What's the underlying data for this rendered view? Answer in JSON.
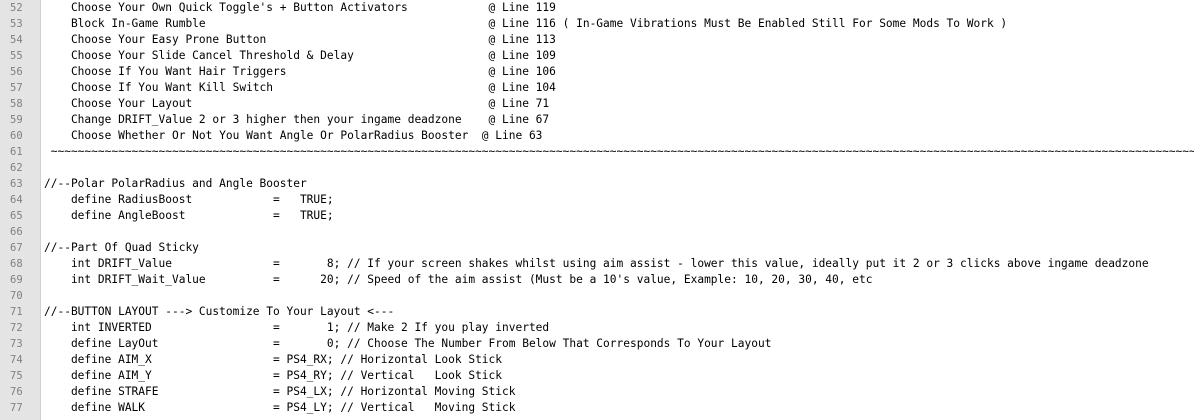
{
  "editor": {
    "lines": [
      {
        "num": "52",
        "text": "    Choose Your Own Quick Toggle's + Button Activators            @ Line 119"
      },
      {
        "num": "53",
        "text": "    Block In-Game Rumble                                          @ Line 116 ( In-Game Vibrations Must Be Enabled Still For Some Mods To Work )"
      },
      {
        "num": "54",
        "text": "    Choose Your Easy Prone Button                                 @ Line 113"
      },
      {
        "num": "55",
        "text": "    Choose Your Slide Cancel Threshold & Delay                    @ Line 109"
      },
      {
        "num": "56",
        "text": "    Choose If You Want Hair Triggers                              @ Line 106"
      },
      {
        "num": "57",
        "text": "    Choose If You Want Kill Switch                                @ Line 104"
      },
      {
        "num": "58",
        "text": "    Choose Your Layout                                            @ Line 71"
      },
      {
        "num": "59",
        "text": "    Change DRIFT_Value 2 or 3 higher then your ingame deadzone    @ Line 67"
      },
      {
        "num": "60",
        "text": "    Choose Whether Or Not You Want Angle Or PolarRadius Booster  @ Line 63"
      },
      {
        "num": "61",
        "text": " ~~~~~~~~~~~~~~~~~~~~~~~~~~~~~~~~~~~~~~~~~~~~~~~~~~~~~~~~~~~~~~~~~~~~~~~~~~~~~~~~~~~~~~~~~~~~~~~~~~~~~~~~~~~~~~~~~~~~~~~~~~~~~~~~~~~~~~~~~~~~~~~~~~~~~~~~~~~~~~~~~~~~~~~~~~~~~~~~~~~~~~~~~~~~~~~~~~~~~"
      },
      {
        "num": "62",
        "text": ""
      },
      {
        "num": "63",
        "text": "//--Polar PolarRadius and Angle Booster"
      },
      {
        "num": "64",
        "text": "    define RadiusBoost            =   TRUE;"
      },
      {
        "num": "65",
        "text": "    define AngleBoost             =   TRUE;"
      },
      {
        "num": "66",
        "text": ""
      },
      {
        "num": "67",
        "text": "//--Part Of Quad Sticky"
      },
      {
        "num": "68",
        "text": "    int DRIFT_Value               =       8; // If your screen shakes whilst using aim assist - lower this value, ideally put it 2 or 3 clicks above ingame deadzone"
      },
      {
        "num": "69",
        "text": "    int DRIFT_Wait_Value          =      20; // Speed of the aim assist (Must be a 10's value, Example: 10, 20, 30, 40, etc"
      },
      {
        "num": "70",
        "text": ""
      },
      {
        "num": "71",
        "text": "//--BUTTON LAYOUT ---> Customize To Your Layout <---"
      },
      {
        "num": "72",
        "text": "    int INVERTED                  =       1; // Make 2 If you play inverted"
      },
      {
        "num": "73",
        "text": "    define LayOut                 =       0; // Choose The Number From Below That Corresponds To Your Layout"
      },
      {
        "num": "74",
        "text": "    define AIM_X                  = PS4_RX; // Horizontal Look Stick"
      },
      {
        "num": "75",
        "text": "    define AIM_Y                  = PS4_RY; // Vertical   Look Stick"
      },
      {
        "num": "76",
        "text": "    define STRAFE                 = PS4_LX; // Horizontal Moving Stick"
      },
      {
        "num": "77",
        "text": "    define WALK                   = PS4_LY; // Vertical   Moving Stick"
      }
    ]
  }
}
